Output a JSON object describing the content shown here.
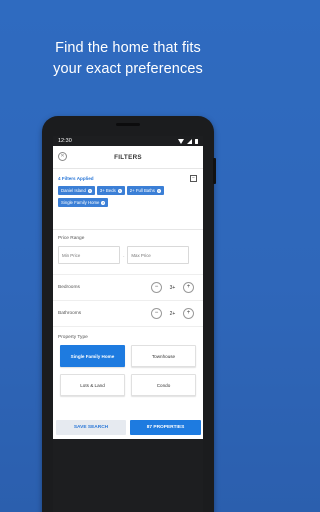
{
  "promo": {
    "line1": "Find the home that fits",
    "line2": "your exact preferences"
  },
  "status_bar": {
    "time": "12:30"
  },
  "header": {
    "title": "FILTERS",
    "close_icon": "close-circle-icon"
  },
  "applied": {
    "title": "4 Filters Applied",
    "chips": [
      "Daniel Island",
      "3+ Beds",
      "2+ Full Baths",
      "Single Family Home"
    ]
  },
  "price": {
    "label": "Price Range",
    "min_placeholder": "Min Price",
    "separator": "-",
    "max_placeholder": "Max Price"
  },
  "bedrooms": {
    "label": "Bedrooms",
    "value": "3+"
  },
  "bathrooms": {
    "label": "Bathrooms",
    "value": "2+"
  },
  "property_type": {
    "label": "Property Type",
    "options": [
      {
        "label": "Single Family Home",
        "selected": true
      },
      {
        "label": "Townhouse",
        "selected": false
      },
      {
        "label": "Lots & Land",
        "selected": false
      },
      {
        "label": "Condo",
        "selected": false
      }
    ]
  },
  "actions": {
    "save_search": "SAVE SEARCH",
    "properties": "87 PROPERTIES"
  },
  "colors": {
    "background": "#2f6bc0",
    "accent": "#1e7be0",
    "chip": "#3b7fd6"
  }
}
